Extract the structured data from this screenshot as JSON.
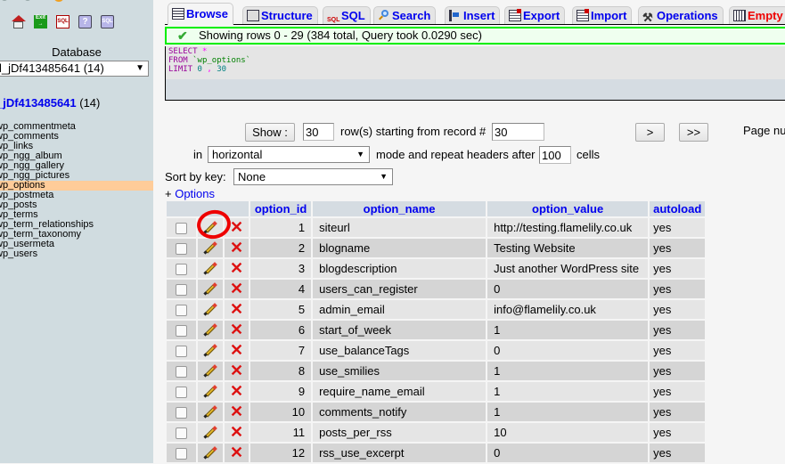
{
  "sidebar": {
    "icons": [
      "home-icon",
      "exit-icon",
      "sql-query-icon",
      "help-icon",
      "sql-docs-icon"
    ],
    "icon_text": {
      "exit": "Exit",
      "sql": "SQL",
      "help": "?",
      "sqlq": "SQL"
    },
    "database_label": "Database",
    "database_select_value": "l_jDf413485641 (14)",
    "database_link": "_jDf413485641",
    "database_link_count": " (14)",
    "tables": [
      {
        "name": "wp_commentmeta",
        "active": false
      },
      {
        "name": "wp_comments",
        "active": false
      },
      {
        "name": "wp_links",
        "active": false
      },
      {
        "name": "wp_ngg_album",
        "active": false
      },
      {
        "name": "wp_ngg_gallery",
        "active": false
      },
      {
        "name": "wp_ngg_pictures",
        "active": false
      },
      {
        "name": "wp_options",
        "active": true
      },
      {
        "name": "wp_postmeta",
        "active": false
      },
      {
        "name": "wp_posts",
        "active": false
      },
      {
        "name": "wp_terms",
        "active": false
      },
      {
        "name": "wp_term_relationships",
        "active": false
      },
      {
        "name": "wp_term_taxonomy",
        "active": false
      },
      {
        "name": "wp_usermeta",
        "active": false
      },
      {
        "name": "wp_users",
        "active": false
      }
    ]
  },
  "tabs": [
    {
      "label": "Browse",
      "icon": "browse-icon",
      "active": true
    },
    {
      "label": "Structure",
      "icon": "structure-icon"
    },
    {
      "label": "SQL",
      "icon": "sql-icon"
    },
    {
      "label": "Search",
      "icon": "search-icon"
    },
    {
      "label": "Insert",
      "icon": "insert-icon"
    },
    {
      "label": "Export",
      "icon": "export-icon"
    },
    {
      "label": "Import",
      "icon": "import-icon"
    },
    {
      "label": "Operations",
      "icon": "operations-icon"
    },
    {
      "label": "Empty",
      "icon": "trash-icon"
    }
  ],
  "message": {
    "text": "Showing rows 0 - 29 (384 total, Query took 0.0290 sec)",
    "status_color": "#00ee00"
  },
  "sql": {
    "select": "SELECT",
    "star": "*",
    "from": "FROM",
    "table": "`wp_options`",
    "limit": "LIMIT",
    "offset": "0",
    "comma": ",",
    "count": "30"
  },
  "navigation": {
    "show_button": "Show :",
    "rows_value": "30",
    "rows_label": "row(s) starting from record #",
    "start_value": "30",
    "next_button": ">",
    "last_button": ">>",
    "page_label": "Page nu",
    "in_label": "in",
    "mode_value": "horizontal",
    "repeat_label": "mode and repeat headers after",
    "repeat_value": "100",
    "cells_label": "cells",
    "sort_label": "Sort by key:",
    "sort_value": "None",
    "options_prefix": "+",
    "options_link": "Options"
  },
  "table": {
    "columns": [
      "option_id",
      "option_name",
      "option_value",
      "autoload"
    ],
    "rows": [
      {
        "option_id": "1",
        "option_name": "siteurl",
        "option_value": "http://testing.flamelily.co.uk",
        "autoload": "yes"
      },
      {
        "option_id": "2",
        "option_name": "blogname",
        "option_value": "Testing Website",
        "autoload": "yes"
      },
      {
        "option_id": "3",
        "option_name": "blogdescription",
        "option_value": "Just another WordPress site",
        "autoload": "yes"
      },
      {
        "option_id": "4",
        "option_name": "users_can_register",
        "option_value": "0",
        "autoload": "yes"
      },
      {
        "option_id": "5",
        "option_name": "admin_email",
        "option_value": "info@flamelily.co.uk",
        "autoload": "yes"
      },
      {
        "option_id": "6",
        "option_name": "start_of_week",
        "option_value": "1",
        "autoload": "yes"
      },
      {
        "option_id": "7",
        "option_name": "use_balanceTags",
        "option_value": "0",
        "autoload": "yes"
      },
      {
        "option_id": "8",
        "option_name": "use_smilies",
        "option_value": "1",
        "autoload": "yes"
      },
      {
        "option_id": "9",
        "option_name": "require_name_email",
        "option_value": "1",
        "autoload": "yes"
      },
      {
        "option_id": "10",
        "option_name": "comments_notify",
        "option_value": "1",
        "autoload": "yes"
      },
      {
        "option_id": "11",
        "option_name": "posts_per_rss",
        "option_value": "10",
        "autoload": "yes"
      },
      {
        "option_id": "12",
        "option_name": "rss_use_excerpt",
        "option_value": "0",
        "autoload": "yes"
      }
    ],
    "delete_glyph": "✕"
  },
  "annotation": {
    "color": "#ee0000",
    "target": "edit row 1"
  }
}
